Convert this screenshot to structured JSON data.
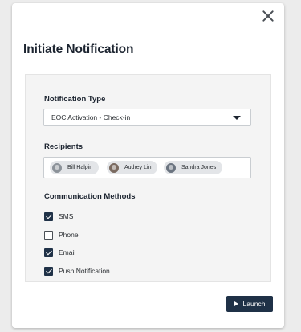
{
  "dialog": {
    "title": "Initiate Notification",
    "close_icon": "close-icon"
  },
  "notification_type": {
    "label": "Notification Type",
    "selected": "EOC Activation - Check-in",
    "caret_icon": "caret-down-icon"
  },
  "recipients": {
    "label": "Recipients",
    "chips": [
      {
        "name": "Bill Halpin",
        "avatar_color": "#8c9299"
      },
      {
        "name": "Audrey Lin",
        "avatar_color": "#7a6a60"
      },
      {
        "name": "Sandra Jones",
        "avatar_color": "#6b7480"
      }
    ]
  },
  "communication_methods": {
    "label": "Communication Methods",
    "options": [
      {
        "label": "SMS",
        "checked": true
      },
      {
        "label": "Phone",
        "checked": false
      },
      {
        "label": "Email",
        "checked": true
      },
      {
        "label": "Push Notification",
        "checked": true
      }
    ]
  },
  "footer": {
    "launch_label": "Launch",
    "launch_icon": "play-icon"
  },
  "colors": {
    "primary": "#1f3147",
    "panel_bg": "#f4f4f4"
  }
}
